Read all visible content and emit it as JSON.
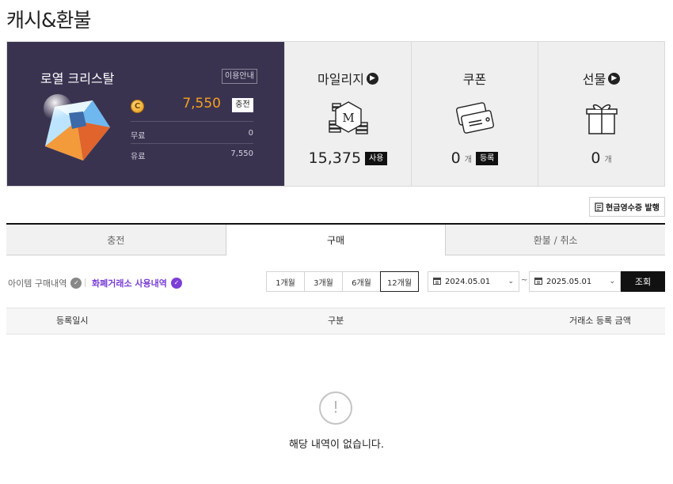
{
  "page": {
    "title": "캐시&환불"
  },
  "crystal": {
    "title": "로열 크리스탈",
    "guide_label": "이용안내",
    "coin_symbol": "C",
    "amount": "7,550",
    "charge_label": "충전",
    "free_label": "무료",
    "free_value": "0",
    "paid_label": "유료",
    "paid_value": "7,550"
  },
  "mileage": {
    "title": "마일리지",
    "value": "15,375",
    "button": "사용",
    "icon_letter": "M"
  },
  "coupon": {
    "title": "쿠폰",
    "value": "0",
    "unit": "개",
    "button": "등록"
  },
  "gift": {
    "title": "선물",
    "value": "0",
    "unit": "개"
  },
  "receipt": {
    "label": "현금영수증 발행"
  },
  "tabs": [
    {
      "label": "충전"
    },
    {
      "label": "구매"
    },
    {
      "label": "환불 / 취소"
    }
  ],
  "subtabs": [
    {
      "label": "아이템 구매내역"
    },
    {
      "label": "화폐거래소 사용내역"
    }
  ],
  "periods": [
    {
      "label": "1개월"
    },
    {
      "label": "3개월"
    },
    {
      "label": "6개월"
    },
    {
      "label": "12개월"
    }
  ],
  "date_from": "2024.05.01",
  "date_to": "2025.05.01",
  "tilde": "~",
  "search_label": "조회",
  "columns": [
    "등록일시",
    "구분",
    "거래소 등록 금액"
  ],
  "empty": {
    "icon": "!",
    "message": "해당 내역이 없습니다."
  },
  "colors": {
    "panel": "#3a3350",
    "gold": "#f5a01f",
    "purple": "#7b3fd6"
  }
}
